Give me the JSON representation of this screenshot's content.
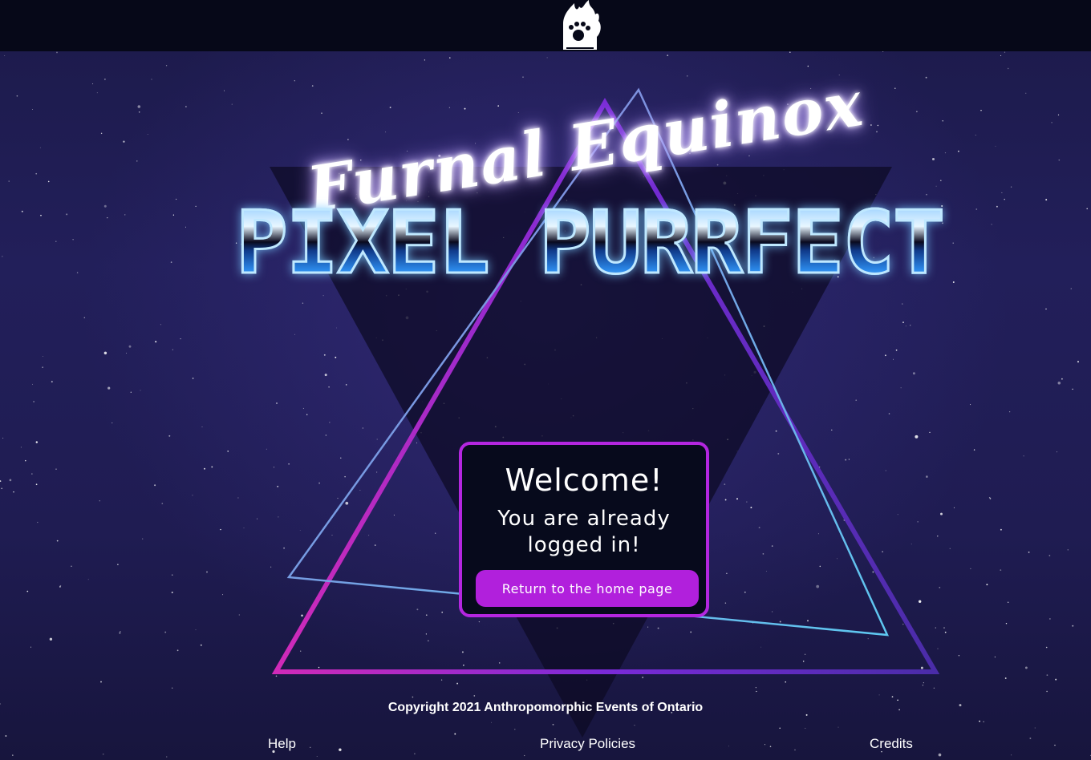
{
  "header": {
    "logo_icon": "paw-flame-logo-icon"
  },
  "banner": {
    "script_title": "Furnal Equinox",
    "block_title": "PIXEL PURRFECT"
  },
  "welcome_card": {
    "heading": "Welcome!",
    "message": "You are already logged in!",
    "button_label": "Return to the home page"
  },
  "footer": {
    "copyright": "Copyright 2021 Anthropomorphic Events of Ontario",
    "links": {
      "help": "Help",
      "privacy": "Privacy Policies",
      "credits": "Credits"
    }
  },
  "colors": {
    "accent": "#b426e0",
    "button": "#b120dc",
    "topbar": "#060818",
    "card_bg": "#070a1c",
    "sky": "#1f1c52"
  }
}
